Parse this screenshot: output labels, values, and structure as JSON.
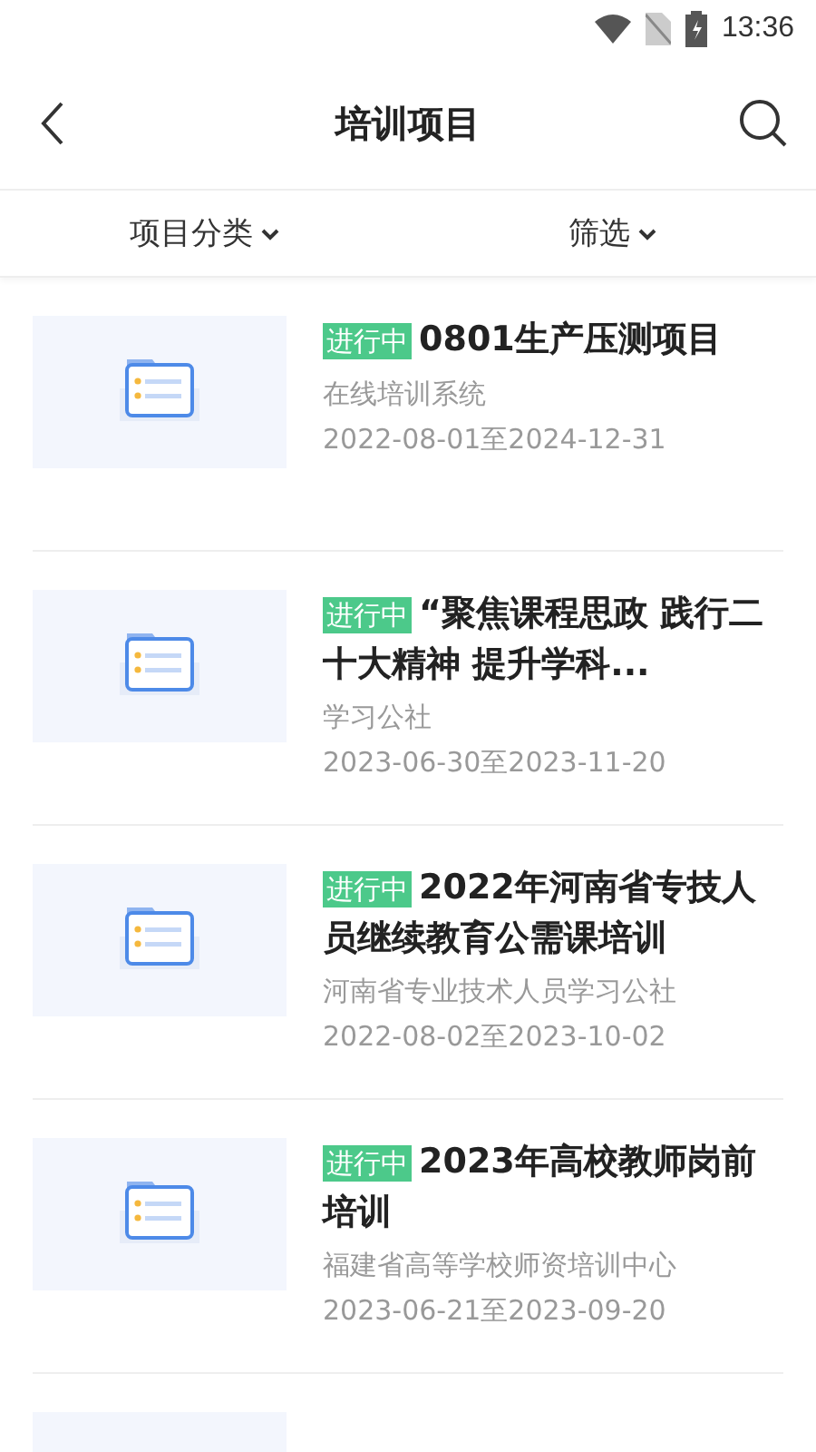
{
  "status_bar": {
    "time": "13:36"
  },
  "header": {
    "title": "培训项目"
  },
  "filters": [
    {
      "label": "项目分类"
    },
    {
      "label": "筛选"
    }
  ],
  "projects": [
    {
      "status": "进行中",
      "title": "0801生产压测项目",
      "org": "在线培训系统",
      "dates": "2022-08-01至2024-12-31"
    },
    {
      "status": "进行中",
      "title": "“聚焦课程思政 践行二十大精神 提升学科...",
      "org": "学习公社",
      "dates": "2023-06-30至2023-11-20"
    },
    {
      "status": "进行中",
      "title": "2022年河南省专技人员继续教育公需课培训",
      "org": "河南省专业技术人员学习公社",
      "dates": "2022-08-02至2023-10-02"
    },
    {
      "status": "进行中",
      "title": "2023年高校教师岗前培训",
      "org": "福建省高等学校师资培训中心",
      "dates": "2023-06-21至2023-09-20"
    }
  ]
}
